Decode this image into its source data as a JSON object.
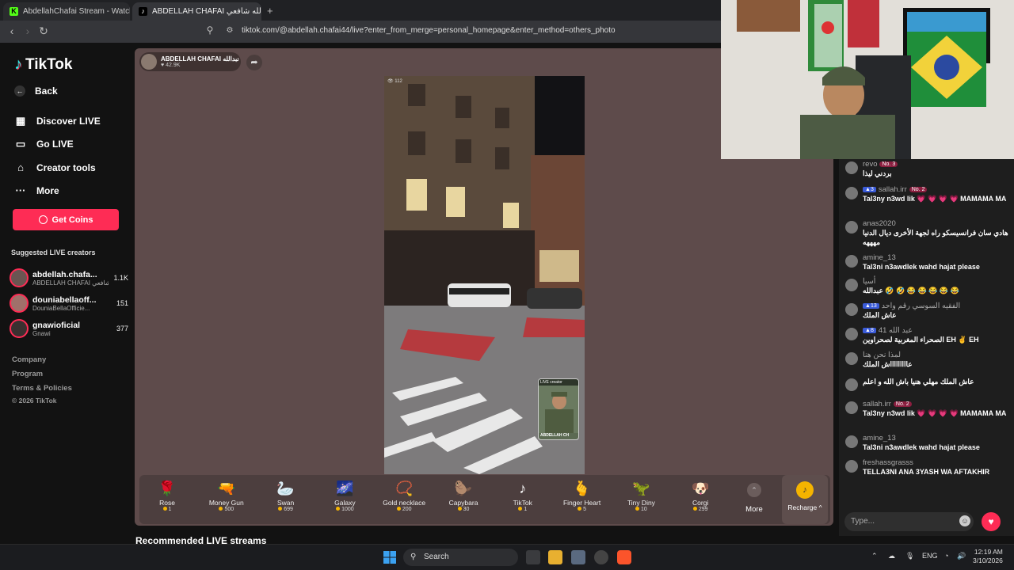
{
  "browser": {
    "tabs": [
      {
        "label": "AbdellahChafai Stream - Watch Live"
      },
      {
        "label": "ABDELLAH CHAFAI عبدالله شافعي"
      }
    ],
    "new_tab": "+",
    "url": "tiktok.com/@abdellah.chafai44/live?enter_from_merge=personal_homepage&enter_method=others_photo"
  },
  "sidebar": {
    "logo": "TikTok",
    "back": "Back",
    "nav": [
      {
        "label": "Discover LIVE",
        "icon": "calendar-icon"
      },
      {
        "label": "Go LIVE",
        "icon": "video-camera-icon"
      },
      {
        "label": "Creator tools",
        "icon": "lightbulb-icon"
      },
      {
        "label": "More",
        "icon": "more-dots-icon"
      }
    ],
    "get_coins": "Get Coins",
    "suggested_title": "Suggested LIVE creators",
    "creators": [
      {
        "name": "abdellah.chafa...",
        "sub": "ABDELLAH CHAFAI شافعي",
        "count": "1.1K"
      },
      {
        "name": "douniabellaoff...",
        "sub": "DouniaBellaOfficie...",
        "count": "151"
      },
      {
        "name": "gnawioficial",
        "sub": "Gnawi",
        "count": "377"
      }
    ],
    "footer": [
      "Company",
      "Program",
      "Terms & Policies",
      "© 2026 TikTok"
    ]
  },
  "live": {
    "host_name": "ABDELLAH CHAFAI شافعي عبدالله",
    "host_likes": "42.9K",
    "viewer_count": "112",
    "pip_label": "LIVE creator",
    "pip_name": "ABDELLAH CH",
    "recommended": "Recommended LIVE streams"
  },
  "gifts": [
    {
      "name": "Rose",
      "price": "1",
      "icon": "🌹"
    },
    {
      "name": "Money Gun",
      "price": "500",
      "icon": "🔫"
    },
    {
      "name": "Swan",
      "price": "699",
      "icon": "🦢"
    },
    {
      "name": "Galaxy",
      "price": "1000",
      "icon": "🌌"
    },
    {
      "name": "Gold necklace",
      "price": "200",
      "icon": "📿"
    },
    {
      "name": "Capybara",
      "price": "30",
      "icon": "🦫"
    },
    {
      "name": "TikTok",
      "price": "1",
      "icon": "♪"
    },
    {
      "name": "Finger Heart",
      "price": "5",
      "icon": "🫰"
    },
    {
      "name": "Tiny Diny",
      "price": "10",
      "icon": "🦖"
    },
    {
      "name": "Corgi",
      "price": "299",
      "icon": "🐶"
    }
  ],
  "gift_more": "More",
  "recharge": "Recharge ^",
  "chat": {
    "messages": [
      {
        "user": "revo",
        "rank": "No. 3",
        "text": "بردني ليذا"
      },
      {
        "user": "sallah.irr",
        "level": "3",
        "rank": "No. 2",
        "text": "Tal3ny n3wd lik 💗 💗 💗 💗 MAMAMA MA"
      },
      {
        "user": "anas2020",
        "text": "هادي سان فرانسيسكو راه لجهة الأخرى ديال الدنيا مهههه"
      },
      {
        "user": "amine_13",
        "text": "Tal3ni n3awdlek wahd hajat please"
      },
      {
        "user": "أسيا",
        "text": "عبدالله 🤣 🤣 😂 😂 😂 😂 😂"
      },
      {
        "user": "الفقيه السوسي رقم واحد",
        "level": "13",
        "text": "عاش الملك"
      },
      {
        "user": "عبد الله 41",
        "level": "8",
        "text": "الصحراء المغربية لصحراوين EH ✌ EH"
      },
      {
        "user": "لمذا نحن هنا",
        "text": "عاااااااااش الملك"
      },
      {
        "user": "",
        "text": "عاش الملك مهلي هنيا باش الله و اعلم"
      },
      {
        "user": "sallah.irr",
        "rank": "No. 2",
        "text": "Tal3ny n3wd lik 💗 💗 💗 💗 MAMAMA MA"
      },
      {
        "user": "amine_13",
        "text": "Tal3ni n3awdlek wahd hajat please"
      },
      {
        "user": "freshassgrasss",
        "text": "TELLA3NI ANA 3YASH WA AFTAKHIR"
      }
    ],
    "placeholder": "Type..."
  },
  "taskbar": {
    "search": "Search",
    "lang": "ENG",
    "time": "12:19 AM",
    "date": "3/10/2026"
  }
}
